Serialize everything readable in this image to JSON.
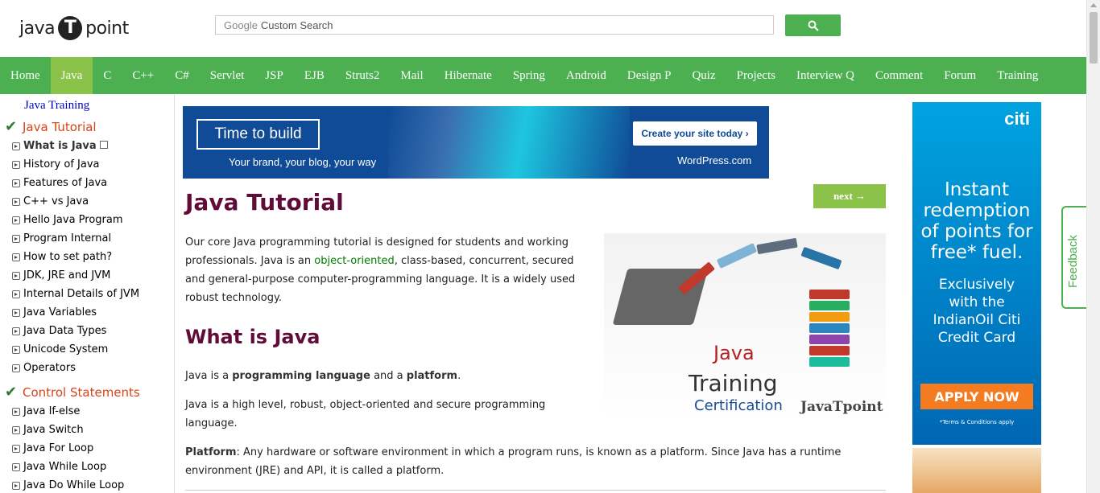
{
  "header": {
    "logo_left": "java",
    "logo_mid": "T",
    "logo_right": "point",
    "search": {
      "brand": "Google",
      "placeholder": "Custom Search"
    },
    "search_button_icon": "search-icon"
  },
  "nav": {
    "items": [
      "Home",
      "Java",
      "C",
      "C++",
      "C#",
      "Servlet",
      "JSP",
      "EJB",
      "Struts2",
      "Mail",
      "Hibernate",
      "Spring",
      "Android",
      "Design P",
      "Quiz",
      "Projects",
      "Interview Q",
      "Comment",
      "Forum",
      "Training"
    ],
    "active": "Java",
    "color": "#4caf50",
    "active_color": "#8bc34a"
  },
  "sidebar": {
    "training_link": "Java Training",
    "section1": "Java Tutorial",
    "section1_items": [
      "What is Java",
      "History of Java",
      "Features of Java",
      "C++ vs Java",
      "Hello Java Program",
      "Program Internal",
      "How to set path?",
      "JDK, JRE and JVM",
      "Internal Details of JVM",
      "Java Variables",
      "Java Data Types",
      "Unicode System",
      "Operators"
    ],
    "section2": "Control Statements",
    "section2_items": [
      "Java If-else",
      "Java Switch",
      "Java For Loop",
      "Java While Loop",
      "Java Do While Loop"
    ]
  },
  "ad_banner": {
    "headline": "Time to build",
    "subline": "Your brand, your blog, your way",
    "cta": "Create your site today ›",
    "brand": "WordPress.com"
  },
  "main": {
    "title": "Java Tutorial",
    "next_label": "next →",
    "intro_1": "Our core Java programming tutorial is designed for students and working",
    "intro_2_pre": "professionals. Java is an ",
    "intro_2_link": "object-oriented",
    "intro_2_post": ", class-based, concurrent, secured",
    "intro_3": "and general-purpose computer-programming language. It is a widely used",
    "intro_4": "robust technology.",
    "section_title": "What is Java",
    "p1_pre": "Java is a ",
    "p1_b1": "programming language",
    "p1_mid": " and a ",
    "p1_b2": "platform",
    "p1_post": ".",
    "p2_1": "Java is a high level, robust, object-oriented and secure programming",
    "p2_2": "language.",
    "p3_label": "Platform",
    "p3_1": ": Any hardware or software environment in which a program runs, is known as a platform. Since Java has a runtime",
    "p3_2": "environment (JRE) and API, it is called a platform.",
    "hero": {
      "java": "Java",
      "training": "Training",
      "cert": "Certification",
      "brand": "JavaTpoint"
    }
  },
  "right_ad": {
    "logo": "citi",
    "headline": [
      "Instant",
      "redemption",
      "of points for",
      "free* fuel."
    ],
    "sub": [
      "Exclusively",
      "with the",
      "IndianOil Citi",
      "Credit Card"
    ],
    "cta": "APPLY NOW",
    "terms": "*Terms & Conditions apply"
  },
  "feedback": "Feedback"
}
